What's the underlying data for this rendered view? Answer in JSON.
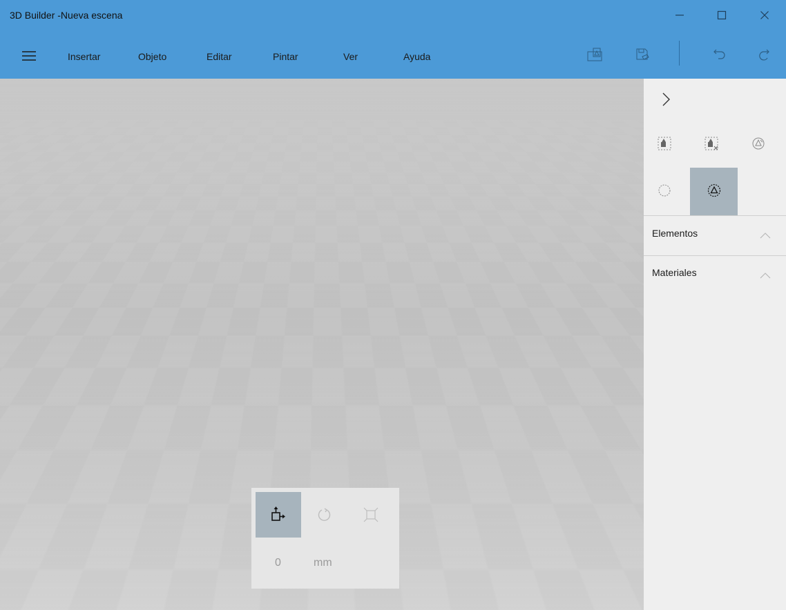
{
  "window": {
    "title": "3D Builder -Nueva escena",
    "controls": [
      "minimize-icon",
      "maximize-icon",
      "close-icon"
    ]
  },
  "menu": {
    "items": [
      "Insertar",
      "Objeto",
      "Editar",
      "Pintar",
      "Ver",
      "Ayuda"
    ]
  },
  "toolbar": {
    "icons": [
      "build-icon",
      "save-icon",
      "undo-icon",
      "redo-icon"
    ]
  },
  "bottom_panel": {
    "tools": [
      "move-icon",
      "rotate-icon",
      "scale-icon"
    ],
    "active_tool": "move-icon",
    "value": "0",
    "unit": "mm"
  },
  "side_panel": {
    "collapse_icon": "chevron-right-icon",
    "icons_row1": [
      "select-all-icon",
      "deselect-icon",
      "repair-icon"
    ],
    "icons_row2": [
      "sphere-icon",
      "object-mode-icon"
    ],
    "sections": [
      {
        "title": "Elementos"
      },
      {
        "title": "Materiales"
      }
    ]
  },
  "colors": {
    "accent": "#4c9ad7",
    "active_tool_bg": "#a7b4bd"
  }
}
